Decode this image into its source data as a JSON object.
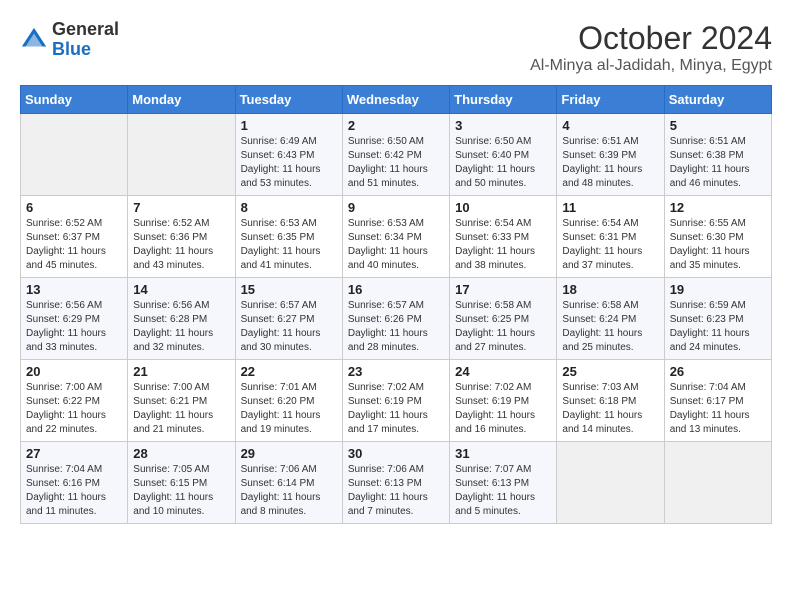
{
  "logo": {
    "general": "General",
    "blue": "Blue"
  },
  "header": {
    "month": "October 2024",
    "location": "Al-Minya al-Jadidah, Minya, Egypt"
  },
  "days_of_week": [
    "Sunday",
    "Monday",
    "Tuesday",
    "Wednesday",
    "Thursday",
    "Friday",
    "Saturday"
  ],
  "weeks": [
    [
      {
        "day": "",
        "sunrise": "",
        "sunset": "",
        "daylight": "",
        "empty": true
      },
      {
        "day": "",
        "sunrise": "",
        "sunset": "",
        "daylight": "",
        "empty": true
      },
      {
        "day": "1",
        "sunrise": "Sunrise: 6:49 AM",
        "sunset": "Sunset: 6:43 PM",
        "daylight": "Daylight: 11 hours and 53 minutes."
      },
      {
        "day": "2",
        "sunrise": "Sunrise: 6:50 AM",
        "sunset": "Sunset: 6:42 PM",
        "daylight": "Daylight: 11 hours and 51 minutes."
      },
      {
        "day": "3",
        "sunrise": "Sunrise: 6:50 AM",
        "sunset": "Sunset: 6:40 PM",
        "daylight": "Daylight: 11 hours and 50 minutes."
      },
      {
        "day": "4",
        "sunrise": "Sunrise: 6:51 AM",
        "sunset": "Sunset: 6:39 PM",
        "daylight": "Daylight: 11 hours and 48 minutes."
      },
      {
        "day": "5",
        "sunrise": "Sunrise: 6:51 AM",
        "sunset": "Sunset: 6:38 PM",
        "daylight": "Daylight: 11 hours and 46 minutes."
      }
    ],
    [
      {
        "day": "6",
        "sunrise": "Sunrise: 6:52 AM",
        "sunset": "Sunset: 6:37 PM",
        "daylight": "Daylight: 11 hours and 45 minutes."
      },
      {
        "day": "7",
        "sunrise": "Sunrise: 6:52 AM",
        "sunset": "Sunset: 6:36 PM",
        "daylight": "Daylight: 11 hours and 43 minutes."
      },
      {
        "day": "8",
        "sunrise": "Sunrise: 6:53 AM",
        "sunset": "Sunset: 6:35 PM",
        "daylight": "Daylight: 11 hours and 41 minutes."
      },
      {
        "day": "9",
        "sunrise": "Sunrise: 6:53 AM",
        "sunset": "Sunset: 6:34 PM",
        "daylight": "Daylight: 11 hours and 40 minutes."
      },
      {
        "day": "10",
        "sunrise": "Sunrise: 6:54 AM",
        "sunset": "Sunset: 6:33 PM",
        "daylight": "Daylight: 11 hours and 38 minutes."
      },
      {
        "day": "11",
        "sunrise": "Sunrise: 6:54 AM",
        "sunset": "Sunset: 6:31 PM",
        "daylight": "Daylight: 11 hours and 37 minutes."
      },
      {
        "day": "12",
        "sunrise": "Sunrise: 6:55 AM",
        "sunset": "Sunset: 6:30 PM",
        "daylight": "Daylight: 11 hours and 35 minutes."
      }
    ],
    [
      {
        "day": "13",
        "sunrise": "Sunrise: 6:56 AM",
        "sunset": "Sunset: 6:29 PM",
        "daylight": "Daylight: 11 hours and 33 minutes."
      },
      {
        "day": "14",
        "sunrise": "Sunrise: 6:56 AM",
        "sunset": "Sunset: 6:28 PM",
        "daylight": "Daylight: 11 hours and 32 minutes."
      },
      {
        "day": "15",
        "sunrise": "Sunrise: 6:57 AM",
        "sunset": "Sunset: 6:27 PM",
        "daylight": "Daylight: 11 hours and 30 minutes."
      },
      {
        "day": "16",
        "sunrise": "Sunrise: 6:57 AM",
        "sunset": "Sunset: 6:26 PM",
        "daylight": "Daylight: 11 hours and 28 minutes."
      },
      {
        "day": "17",
        "sunrise": "Sunrise: 6:58 AM",
        "sunset": "Sunset: 6:25 PM",
        "daylight": "Daylight: 11 hours and 27 minutes."
      },
      {
        "day": "18",
        "sunrise": "Sunrise: 6:58 AM",
        "sunset": "Sunset: 6:24 PM",
        "daylight": "Daylight: 11 hours and 25 minutes."
      },
      {
        "day": "19",
        "sunrise": "Sunrise: 6:59 AM",
        "sunset": "Sunset: 6:23 PM",
        "daylight": "Daylight: 11 hours and 24 minutes."
      }
    ],
    [
      {
        "day": "20",
        "sunrise": "Sunrise: 7:00 AM",
        "sunset": "Sunset: 6:22 PM",
        "daylight": "Daylight: 11 hours and 22 minutes."
      },
      {
        "day": "21",
        "sunrise": "Sunrise: 7:00 AM",
        "sunset": "Sunset: 6:21 PM",
        "daylight": "Daylight: 11 hours and 21 minutes."
      },
      {
        "day": "22",
        "sunrise": "Sunrise: 7:01 AM",
        "sunset": "Sunset: 6:20 PM",
        "daylight": "Daylight: 11 hours and 19 minutes."
      },
      {
        "day": "23",
        "sunrise": "Sunrise: 7:02 AM",
        "sunset": "Sunset: 6:19 PM",
        "daylight": "Daylight: 11 hours and 17 minutes."
      },
      {
        "day": "24",
        "sunrise": "Sunrise: 7:02 AM",
        "sunset": "Sunset: 6:19 PM",
        "daylight": "Daylight: 11 hours and 16 minutes."
      },
      {
        "day": "25",
        "sunrise": "Sunrise: 7:03 AM",
        "sunset": "Sunset: 6:18 PM",
        "daylight": "Daylight: 11 hours and 14 minutes."
      },
      {
        "day": "26",
        "sunrise": "Sunrise: 7:04 AM",
        "sunset": "Sunset: 6:17 PM",
        "daylight": "Daylight: 11 hours and 13 minutes."
      }
    ],
    [
      {
        "day": "27",
        "sunrise": "Sunrise: 7:04 AM",
        "sunset": "Sunset: 6:16 PM",
        "daylight": "Daylight: 11 hours and 11 minutes."
      },
      {
        "day": "28",
        "sunrise": "Sunrise: 7:05 AM",
        "sunset": "Sunset: 6:15 PM",
        "daylight": "Daylight: 11 hours and 10 minutes."
      },
      {
        "day": "29",
        "sunrise": "Sunrise: 7:06 AM",
        "sunset": "Sunset: 6:14 PM",
        "daylight": "Daylight: 11 hours and 8 minutes."
      },
      {
        "day": "30",
        "sunrise": "Sunrise: 7:06 AM",
        "sunset": "Sunset: 6:13 PM",
        "daylight": "Daylight: 11 hours and 7 minutes."
      },
      {
        "day": "31",
        "sunrise": "Sunrise: 7:07 AM",
        "sunset": "Sunset: 6:13 PM",
        "daylight": "Daylight: 11 hours and 5 minutes."
      },
      {
        "day": "",
        "sunrise": "",
        "sunset": "",
        "daylight": "",
        "empty": true
      },
      {
        "day": "",
        "sunrise": "",
        "sunset": "",
        "daylight": "",
        "empty": true
      }
    ]
  ]
}
